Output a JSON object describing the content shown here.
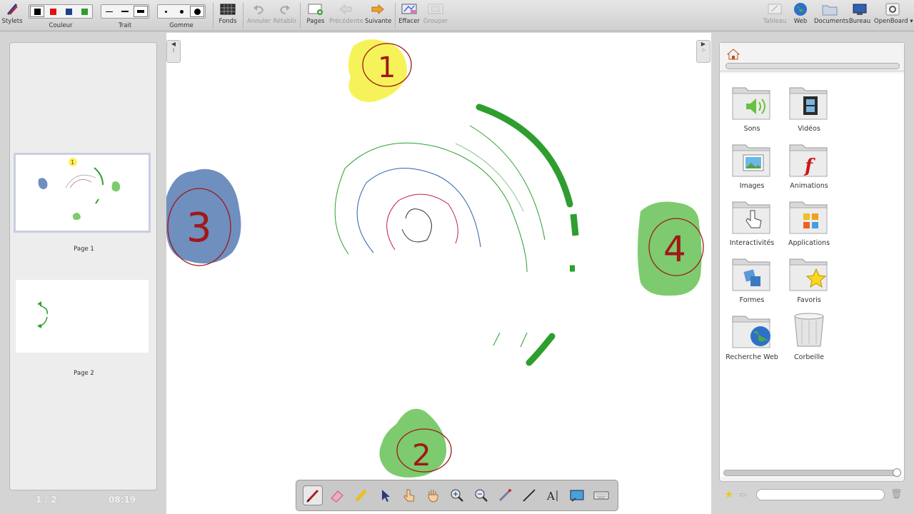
{
  "toolbar": {
    "stylets": "Stylets",
    "couleur": "Couleur",
    "trait": "Trait",
    "gomme": "Gomme",
    "fonds": "Fonds",
    "annuler": "Annuler",
    "retablir": "Rétablir",
    "pages": "Pages",
    "precedente": "Précédente",
    "suivante": "Suivante",
    "effacer": "Effacer",
    "grouper": "Grouper",
    "tableau": "Tableau",
    "web": "Web",
    "documents": "Documents",
    "bureau": "Bureau",
    "openboard": "OpenBoard"
  },
  "colors": {
    "swatches": [
      "#000000",
      "#e01010",
      "#1e3f8c",
      "#2e9e2e"
    ],
    "selected": 0
  },
  "pages": {
    "items": [
      {
        "label": "Page 1",
        "thumb_labels": [
          "1"
        ]
      },
      {
        "label": "Page 2"
      }
    ],
    "counter": "1 / 2",
    "time": "08:19"
  },
  "board": {
    "blobs": [
      {
        "name": "blob-1",
        "color": "#f6f35a",
        "text": "1"
      },
      {
        "name": "blob-2",
        "color": "#7dcb6e",
        "text": "2"
      },
      {
        "name": "blob-3",
        "color": "#6f8fbf",
        "text": "3"
      },
      {
        "name": "blob-4",
        "color": "#7dcb6e",
        "text": "4"
      }
    ]
  },
  "library": {
    "items": [
      {
        "label": "Sons",
        "icon": "speaker-icon"
      },
      {
        "label": "Vidéos",
        "icon": "film-icon"
      },
      {
        "label": "Images",
        "icon": "picture-icon"
      },
      {
        "label": "Animations",
        "icon": "flash-icon"
      },
      {
        "label": "Interactivités",
        "icon": "hand-pointer-icon"
      },
      {
        "label": "Applications",
        "icon": "apps-icon"
      },
      {
        "label": "Formes",
        "icon": "shapes-icon"
      },
      {
        "label": "Favoris",
        "icon": "star-icon"
      },
      {
        "label": "Recherche Web",
        "icon": "globe-icon"
      },
      {
        "label": "Corbeille",
        "icon": "trash-icon"
      }
    ],
    "search_value": ""
  }
}
